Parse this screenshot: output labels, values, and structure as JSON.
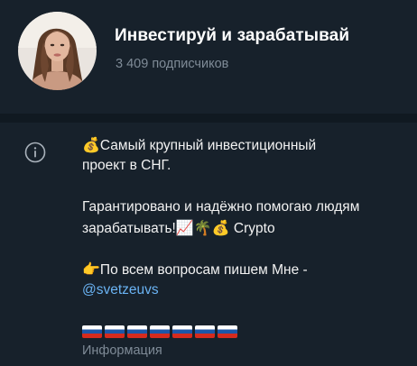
{
  "channel": {
    "title": "Инвестируй и зарабатывай",
    "subscribers": "3 409 подписчиков"
  },
  "info": {
    "icon": "info-icon",
    "line1_emoji": "💰",
    "line1_text": "Самый крупный инвестиционный",
    "line2_text": "проект в СНГ.",
    "line3_text": "Гарантировано и надёжно помогаю людям",
    "line4_text": "зарабатывать!",
    "line4_emojis": "📈🌴💰",
    "line4_tail": " Crypto",
    "line5_emoji": "👉",
    "line5_text": "По всем вопросам пишем Мне -",
    "link_text": "@svetzeuvs",
    "flags_count": 7,
    "label": "Информация"
  },
  "colors": {
    "background": "#17212b",
    "divider": "#101921",
    "muted": "#7f8b97",
    "link": "#6ab3f3"
  }
}
